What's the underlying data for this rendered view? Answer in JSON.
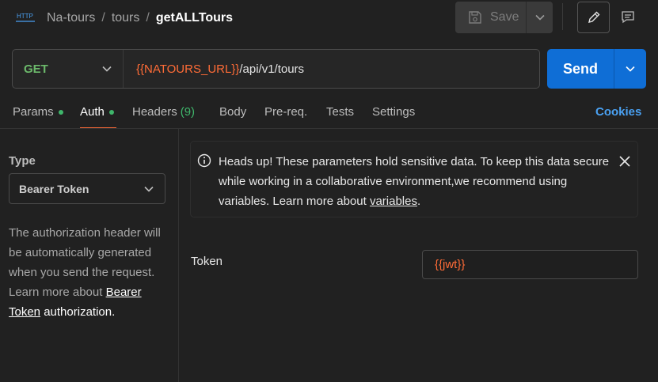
{
  "breadcrumb": {
    "icon": "http-request-icon",
    "collection": "Na-tours",
    "folder": "tours",
    "separator": "/",
    "request": "getALLTours"
  },
  "toolbar": {
    "save_label": "Save",
    "save_icon": "save-icon",
    "edit_icon": "pencil-icon",
    "comments_icon": "comment-icon"
  },
  "request": {
    "method": "GET",
    "url_variable": "{{NATOURS_URL}}",
    "url_path": "/api/v1/tours",
    "send_label": "Send"
  },
  "tabs": [
    {
      "label": "Params",
      "indicator": true,
      "count": ""
    },
    {
      "label": "Auth",
      "indicator": true,
      "count": "",
      "active": true
    },
    {
      "label": "Headers",
      "indicator": false,
      "count": "(9)"
    },
    {
      "label": "Body",
      "indicator": false,
      "count": ""
    },
    {
      "label": "Pre-req.",
      "indicator": false,
      "count": ""
    },
    {
      "label": "Tests",
      "indicator": false,
      "count": ""
    },
    {
      "label": "Settings",
      "indicator": false,
      "count": ""
    }
  ],
  "cookies_label": "Cookies",
  "auth": {
    "type_label": "Type",
    "type_value": "Bearer Token",
    "help_text": "The authorization header will be automatically generated when you send the request. Learn more about",
    "help_link": "Bearer Token",
    "help_tail": "authorization."
  },
  "alert": {
    "text": "Heads up! These parameters hold sensitive data. To keep this data secure while working in a collaborative environment,we recommend using variables. Learn more about",
    "link": "variables",
    "tail": "."
  },
  "token": {
    "label": "Token",
    "value": "{{jwt}}"
  },
  "colors": {
    "accent": "#ff6c37",
    "send": "#0f6ed6",
    "method_get": "#6cb96b",
    "indicator": "#3fb66b",
    "cookies": "#4aa1f2"
  }
}
